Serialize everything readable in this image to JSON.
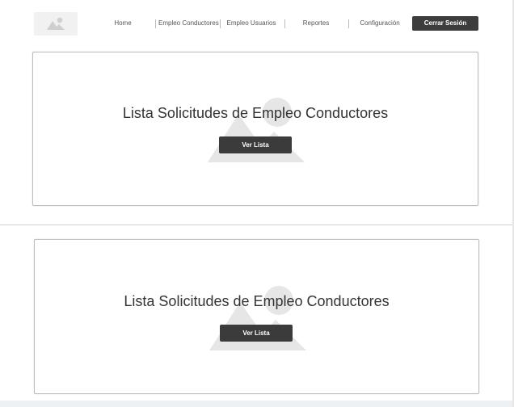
{
  "header": {
    "logo_icon": "image-placeholder-icon",
    "nav": [
      {
        "label": "Home"
      },
      {
        "label": "Empleo Conductores"
      },
      {
        "label": "Empleo Usuarios"
      },
      {
        "label": "Reportes"
      },
      {
        "label": "Configuración"
      }
    ],
    "logout_label": "Cerrar Sesión"
  },
  "cards": [
    {
      "title": "Lista Solicitudes de Empleo Conductores",
      "button_label": "Ver Lista",
      "background_icon": "image-placeholder-icon"
    },
    {
      "title": "Lista Solicitudes de Empleo Conductores",
      "button_label": "Ver Lista",
      "background_icon": "image-placeholder-icon"
    }
  ],
  "colors": {
    "button_bg": "#3b3b3b",
    "card_border": "#bdbdbd",
    "placeholder_gray": "#e6e6e6"
  }
}
